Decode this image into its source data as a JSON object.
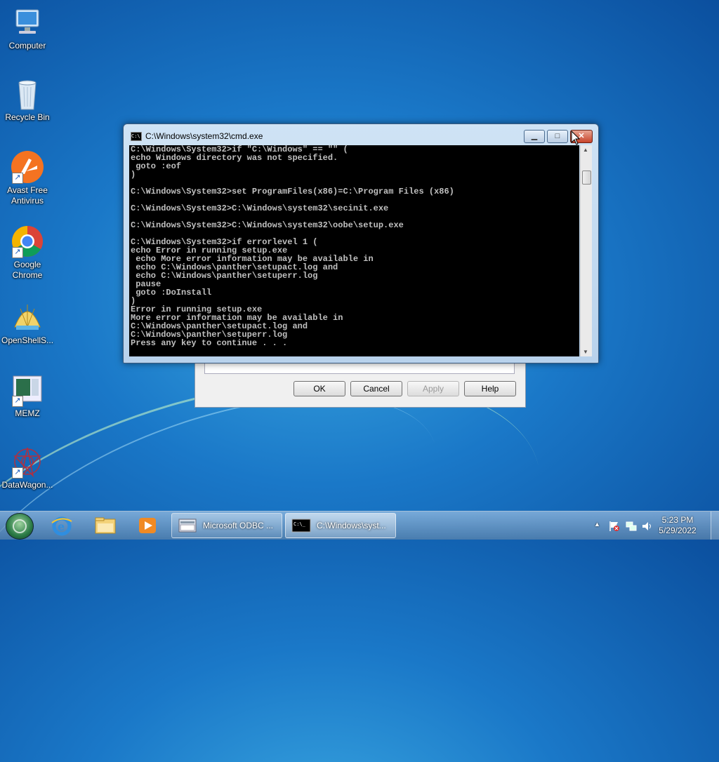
{
  "desktop": {
    "icons": [
      {
        "label": "Computer"
      },
      {
        "label": "Recycle Bin"
      },
      {
        "label": "Avast Free Antivirus"
      },
      {
        "label": "Google Chrome"
      },
      {
        "label": "OpenShellS..."
      },
      {
        "label": "MEMZ"
      },
      {
        "label": "DataWagon..."
      }
    ]
  },
  "dialog": {
    "ok_label": "OK",
    "cancel_label": "Cancel",
    "apply_label": "Apply",
    "help_label": "Help"
  },
  "cmd": {
    "title": "C:\\Windows\\system32\\cmd.exe",
    "icon_text": "C:\\",
    "minimize": "▁",
    "maximize": "□",
    "close": "✕",
    "lines": [
      "C:\\Windows\\System32>if \"C:\\Windows\" == \"\" (",
      "echo Windows directory was not specified.",
      " goto :eof",
      ")",
      "",
      "C:\\Windows\\System32>set ProgramFiles(x86)=C:\\Program Files (x86)",
      "",
      "C:\\Windows\\System32>C:\\Windows\\system32\\secinit.exe",
      "",
      "C:\\Windows\\System32>C:\\Windows\\system32\\oobe\\setup.exe",
      "",
      "C:\\Windows\\System32>if errorlevel 1 (",
      "echo Error in running setup.exe",
      " echo More error information may be available in",
      " echo C:\\Windows\\panther\\setupact.log and",
      " echo C:\\Windows\\panther\\setuperr.log",
      " pause",
      " goto :DoInstall",
      ")",
      "Error in running setup.exe",
      "More error information may be available in",
      "C:\\Windows\\panther\\setupact.log and",
      "C:\\Windows\\panther\\setuperr.log",
      "Press any key to continue . . ."
    ]
  },
  "taskbar": {
    "tasks": [
      {
        "label": "Microsoft ODBC ..."
      },
      {
        "label": "C:\\Windows\\syst..."
      }
    ],
    "clock_time": "5:23 PM",
    "clock_date": "5/29/2022",
    "tray_arrow": "▲"
  },
  "colors": {
    "desktop": "#1a78c8",
    "console_bg": "#000000",
    "console_text": "#c0c0c0"
  }
}
